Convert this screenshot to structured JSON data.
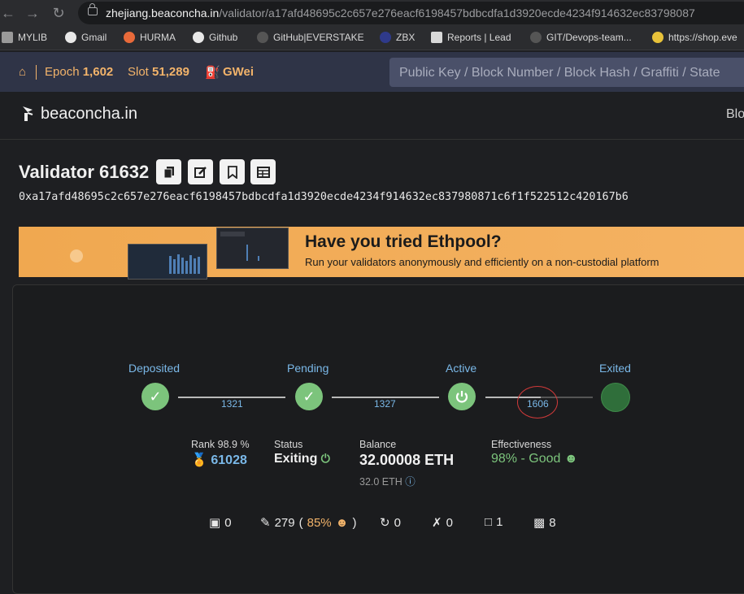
{
  "browser": {
    "url_host": "zhejiang.beaconcha.in",
    "url_path": "/validator/a17afd48695c2c657e276eacf6198457bdbcdfa1d3920ecde4234f914632ec83798087",
    "bookmarks": [
      "MYLIB",
      "Gmail",
      "HURMA",
      "Github",
      "GitHub|EVERSTAKE",
      "ZBX",
      "Reports | Lead",
      "GIT/Devops-team...",
      "https://shop.eve"
    ]
  },
  "topbar": {
    "epoch_label": "Epoch",
    "epoch_value": "1,602",
    "slot_label": "Slot",
    "slot_value": "51,289",
    "gas_label": "GWei",
    "search_placeholder": "Public Key / Block Number / Block Hash / Graffiti / State"
  },
  "header": {
    "logo": "beaconcha.in",
    "nav_right": "Blo"
  },
  "validator": {
    "title": "Validator 61632",
    "pubkey": "0xa17afd48695c2c657e276eacf6198457bdbcdfa1d3920ecde4234f914632ec837980871c6f1f522512c420167b6"
  },
  "banner": {
    "title": "Have you tried Ethpool?",
    "subtitle": "Run your validators anonymously and efficiently on a non-custodial platform"
  },
  "lifecycle": {
    "steps": [
      "Deposited",
      "Pending",
      "Active",
      "Exited"
    ],
    "durations": [
      "1321",
      "1327",
      "1606"
    ]
  },
  "stats": {
    "rank_label": "Rank 98.9 %",
    "rank_value": "61028",
    "status_label": "Status",
    "status_value": "Exiting",
    "balance_label": "Balance",
    "balance_value": "32.00008 ETH",
    "balance_sub": "32.0 ETH",
    "effectiveness_label": "Effectiveness",
    "effectiveness_value": "98% - Good"
  },
  "counters": {
    "proposals": "0",
    "attestations": "279",
    "attestations_pct": "85%",
    "sync": "0",
    "slashings": "0",
    "deposits": "1",
    "withdrawals": "8"
  },
  "colors": {
    "accent_orange": "#f2b36a",
    "step_green": "#7cc47c",
    "link_blue": "#7ab8e8",
    "good_green": "#7cc47c"
  }
}
